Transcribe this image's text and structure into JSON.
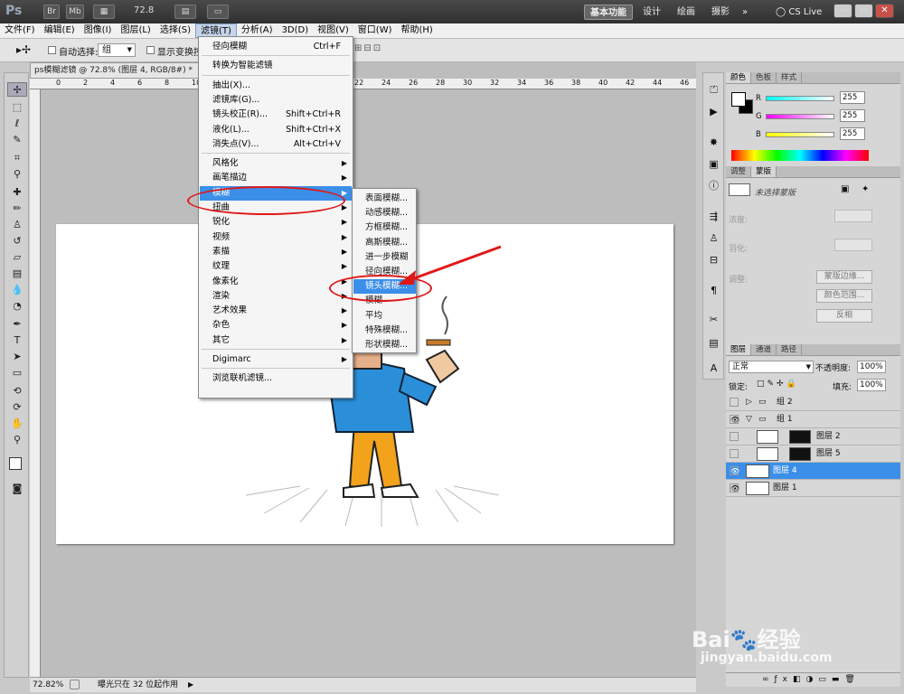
{
  "appbar": {
    "logo": "Ps",
    "btn_br": "Br",
    "btn_mb": "Mb",
    "zoom": "72.8",
    "workspaces": [
      "基本功能",
      "设计",
      "绘画",
      "摄影"
    ],
    "more": "»",
    "cslive": "CS Live"
  },
  "menubar": [
    "文件(F)",
    "编辑(E)",
    "图像(I)",
    "图层(L)",
    "选择(S)",
    "滤镜(T)",
    "分析(A)",
    "3D(D)",
    "视图(V)",
    "窗口(W)",
    "帮助(H)"
  ],
  "optbar": {
    "autoselect_label": "自动选择:",
    "autoselect_value": "组",
    "transform_label": "显示变换控"
  },
  "doc": {
    "tab_title": "ps模糊滤镜 @ 72.8% (图层 4, RGB/8#) *",
    "ruler_marks": [
      "0",
      "2",
      "4",
      "6",
      "8",
      "10",
      "12",
      "14",
      "16",
      "18",
      "20",
      "22",
      "24",
      "26",
      "28",
      "30",
      "32",
      "34",
      "36",
      "38",
      "40",
      "42",
      "44",
      "46"
    ],
    "status_zoom": "72.82%",
    "status_text": "曝光只在 32 位起作用"
  },
  "filter_menu": {
    "top": [
      {
        "label": "径向模糊",
        "shortcut": "Ctrl+F"
      },
      {
        "label": "转换为智能滤镜",
        "shortcut": ""
      },
      {
        "label": "抽出(X)...",
        "shortcut": ""
      },
      {
        "label": "滤镜库(G)...",
        "shortcut": ""
      },
      {
        "label": "镜头校正(R)...",
        "shortcut": "Shift+Ctrl+R"
      },
      {
        "label": "液化(L)...",
        "shortcut": "Shift+Ctrl+X"
      },
      {
        "label": "消失点(V)...",
        "shortcut": "Alt+Ctrl+V"
      }
    ],
    "categories": [
      "风格化",
      "画笔描边",
      "模糊",
      "扭曲",
      "锐化",
      "视频",
      "素描",
      "纹理",
      "像素化",
      "渲染",
      "艺术效果",
      "杂色",
      "其它"
    ],
    "digimarc": "Digimarc",
    "browse": "浏览联机滤镜..."
  },
  "blur_submenu": [
    "表面模糊...",
    "动感模糊...",
    "方框模糊...",
    "高斯模糊...",
    "进一步模糊",
    "径向模糊...",
    "镜头模糊...",
    "模糊",
    "平均",
    "特殊模糊...",
    "形状模糊..."
  ],
  "color_panel": {
    "tabs": [
      "颜色",
      "色板",
      "样式"
    ],
    "r_label": "R",
    "g_label": "G",
    "b_label": "B",
    "r": "255",
    "g": "255",
    "b": "255"
  },
  "adjust_panel": {
    "tabs": [
      "调整",
      "蒙版"
    ],
    "no_mask": "未选择蒙版",
    "density": "浓度:",
    "feather": "羽化:",
    "refine": "调整:",
    "edge_btn": "蒙版边缘...",
    "range_btn": "颜色范围...",
    "invert_btn": "反相"
  },
  "layers_panel": {
    "tabs": [
      "图层",
      "通道",
      "路径"
    ],
    "blend": "正常",
    "opacity_label": "不透明度:",
    "opacity": "100%",
    "lock_label": "锁定:",
    "fill_label": "填充:",
    "fill": "100%",
    "layers": [
      {
        "name": "组 2",
        "kind": "group",
        "visible": false,
        "selected": false
      },
      {
        "name": "组 1",
        "kind": "group",
        "visible": true,
        "selected": false
      },
      {
        "name": "图层 2",
        "kind": "layer-mask",
        "visible": false,
        "selected": false
      },
      {
        "name": "图层 5",
        "kind": "layer-mask",
        "visible": false,
        "selected": false
      },
      {
        "name": "图层 4",
        "kind": "layer",
        "visible": true,
        "selected": true
      },
      {
        "name": "图层 1",
        "kind": "layer",
        "visible": true,
        "selected": false
      }
    ]
  },
  "watermark": {
    "brand": "Bai",
    "brand2": "经验",
    "url": "jingyan.baidu.com"
  },
  "colors": {
    "highlight": "#3b8fe8",
    "annotation": "#e01818"
  }
}
